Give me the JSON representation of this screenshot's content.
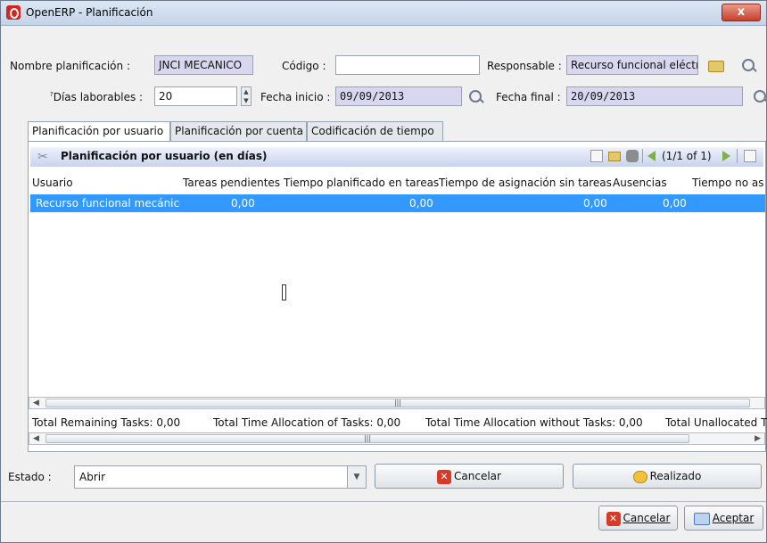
{
  "window": {
    "title": "OpenERP - Planificación",
    "close": "x"
  },
  "form": {
    "name_label": "Nombre planificación :",
    "name_value": "JNCI MECANICO",
    "code_label": "Código :",
    "code_value": "",
    "responsible_label": "Responsable :",
    "responsible_value": "Recurso funcional eléctr",
    "workdays_label": "Días laborables :",
    "workdays_value": "20",
    "start_label": "Fecha inicio :",
    "start_value": "09/09/2013",
    "end_label": "Fecha final :",
    "end_value": "20/09/2013"
  },
  "tabs": [
    "Planificación por usuario",
    "Planificación por cuenta",
    "Codificación de tiempo"
  ],
  "grid": {
    "title": "Planificación por usuario (en días)",
    "pager": "(1/1 of 1)",
    "columns": [
      "Usuario",
      "Tareas pendientes",
      "Tiempo planificado en tareas",
      "Tiempo de asignación sin tareas",
      "Ausencias",
      "Tiempo no as"
    ],
    "rows": [
      {
        "usuario": "Recurso funcional mecánico",
        "tareas": "0,00",
        "planificado": "0,00",
        "sin_tareas": "0,00",
        "ausencias": "0,00"
      }
    ],
    "totals": [
      "Total Remaining Tasks: 0,00",
      "Total Time Allocation of Tasks: 0,00",
      "Total Time Allocation without Tasks: 0,00",
      "Total Unallocated T"
    ]
  },
  "footer": {
    "state_label": "Estado :",
    "state_value": "Abrir",
    "cancel_state": "Cancelar",
    "done": "Realizado",
    "cancel": "Cancelar",
    "accept": "Aceptar"
  },
  "colors": {
    "selection": "#3399ff",
    "required_field": "#d9d7f0",
    "close_button": "#c8402a"
  }
}
